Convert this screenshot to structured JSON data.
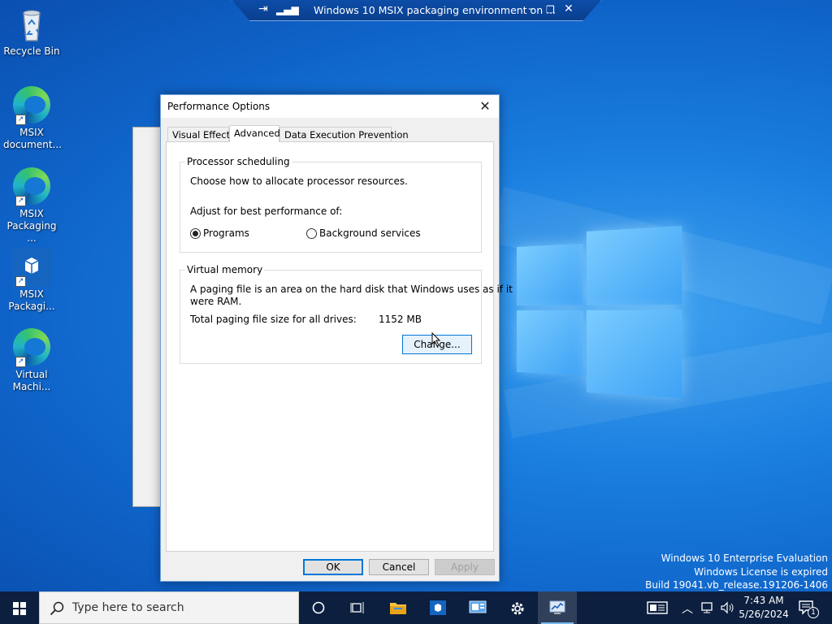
{
  "desktop": {
    "icons": [
      {
        "label": "Recycle Bin"
      },
      {
        "label": "MSIX document..."
      },
      {
        "label": "MSIX Packaging ..."
      },
      {
        "label": "MSIX Packagi..."
      },
      {
        "label": "Virtual Machi..."
      }
    ]
  },
  "rdp_bar": {
    "title": "Windows 10 MSIX packaging environment on ..."
  },
  "dialog": {
    "title": "Performance Options",
    "tabs": [
      {
        "label": "Visual Effects"
      },
      {
        "label": "Advanced",
        "active": true
      },
      {
        "label": "Data Execution Prevention"
      }
    ],
    "processor": {
      "legend": "Processor scheduling",
      "description": "Choose how to allocate processor resources.",
      "adjust_label": "Adjust for best performance of:",
      "options": [
        {
          "label": "Programs",
          "selected": true
        },
        {
          "label": "Background services",
          "selected": false
        }
      ]
    },
    "virtual_memory": {
      "legend": "Virtual memory",
      "description_line1": "A paging file is an area on the hard disk that Windows uses as if it",
      "description_line2": "were RAM.",
      "total_label": "Total paging file size for all drives:",
      "total_value": "1152 MB",
      "change_button": "Change..."
    },
    "buttons": {
      "ok": "OK",
      "cancel": "Cancel",
      "apply": "Apply"
    }
  },
  "watermark": {
    "line1": "Windows 10 Enterprise Evaluation",
    "line2": "Windows License is expired",
    "line3": "Build 19041.vb_release.191206-1406"
  },
  "taskbar": {
    "search_placeholder": "Type here to search",
    "clock_time": "7:43 AM",
    "clock_date": "5/26/2024",
    "notification_count": "1"
  },
  "colors": {
    "accent": "#0078d7",
    "taskbar": "#0c1f3f",
    "desktop": "#1a7fe0"
  }
}
